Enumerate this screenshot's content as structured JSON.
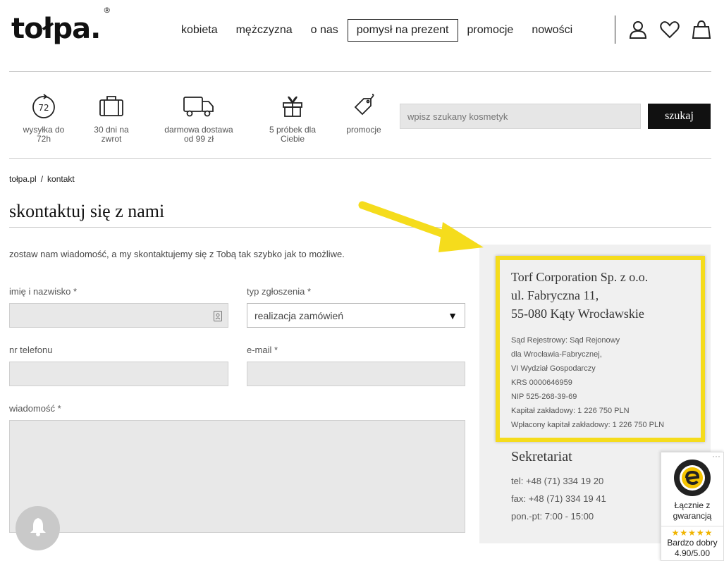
{
  "header": {
    "logo": "tołpa.",
    "logo_mark": "®",
    "nav": [
      {
        "label": "kobieta"
      },
      {
        "label": "mężczyzna"
      },
      {
        "label": "o nas"
      },
      {
        "label": "pomysł na prezent"
      },
      {
        "label": "promocje"
      },
      {
        "label": "nowości"
      }
    ],
    "icons": [
      "user-icon",
      "heart-icon",
      "shopping-bag-icon"
    ]
  },
  "features": [
    {
      "icon": "72h-clock-icon",
      "line1": "wysyłka do",
      "line2": "72h"
    },
    {
      "icon": "suitcase-icon",
      "line1": "30 dni na",
      "line2": "zwrot"
    },
    {
      "icon": "truck-icon",
      "line1": "darmowa dostawa",
      "line2": "od 99 zł"
    },
    {
      "icon": "gift-icon",
      "line1": "5 próbek dla",
      "line2": "Ciebie"
    },
    {
      "icon": "tag-icon",
      "line1": "promocje",
      "line2": ""
    }
  ],
  "search": {
    "placeholder": "wpisz szukany kosmetyk",
    "button_label": "szukaj"
  },
  "breadcrumb": {
    "home": "tołpa.pl",
    "separator": "/",
    "current": "kontakt"
  },
  "page": {
    "title": "skontaktuj się z nami",
    "intro": "zostaw nam wiadomość, a my skontaktujemy się z Tobą tak szybko jak to możliwe."
  },
  "form": {
    "name_label": "imię i nazwisko *",
    "type_label": "typ zgłoszenia *",
    "type_value": "realizacja zamówień",
    "phone_label": "nr telefonu",
    "email_label": "e-mail *",
    "message_label": "wiadomość *"
  },
  "company": {
    "line1": "Torf Corporation Sp. z o.o.",
    "line2": "ul. Fabryczna 11,",
    "line3": "55-080 Kąty Wrocławskie",
    "reg": [
      "Sąd Rejestrowy: Sąd Rejonowy",
      "dla Wrocławia-Fabrycznej,",
      "VI Wydział Gospodarczy",
      "KRS 0000646959",
      "NIP 525-268-39-69",
      "Kapitał zakładowy: 1 226 750 PLN",
      "Wpłacony kapitał zakładowy: 1 226 750 PLN"
    ]
  },
  "secretariat": {
    "title": "Sekretariat",
    "tel": "tel: +48 (71) 334 19 20",
    "fax": "fax: +48 (71) 334 19 41",
    "hours": "pon.-pt: 7:00 - 15:00"
  },
  "trusted_shops": {
    "dots": "···",
    "guarantee_line1": "Łącznie z",
    "guarantee_line2": "gwarancją",
    "stars": "★★★★★",
    "rating_label": "Bardzo dobry",
    "rating_value": "4.90/5.00",
    "rating": 4.9
  },
  "colors": {
    "highlight": "#f5dc1c",
    "button_bg": "#111111",
    "panel_bg": "#f0f0f0",
    "star": "#f0b400"
  }
}
